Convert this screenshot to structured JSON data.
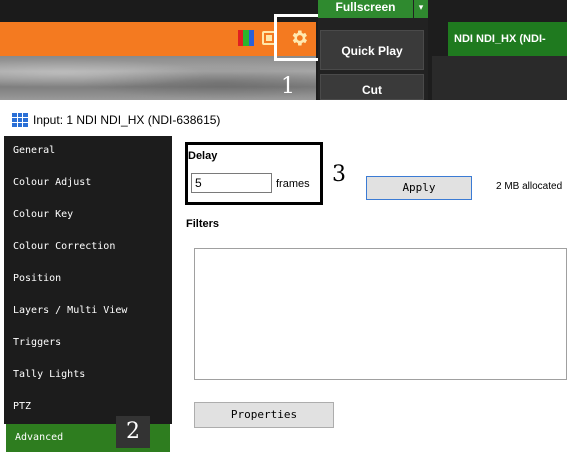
{
  "toolbar": {
    "fullscreen_label": "Fullscreen",
    "quick_play_label": "Quick Play",
    "cut_label": "Cut",
    "preview_title": "NDI NDI_HX (NDI-"
  },
  "callouts": {
    "one": "1",
    "two": "2",
    "three": "3"
  },
  "dialog": {
    "title": "Input: 1 NDI NDI_HX (NDI-638615)"
  },
  "sidebar": {
    "items": [
      {
        "label": "General"
      },
      {
        "label": "Colour Adjust"
      },
      {
        "label": "Colour Key"
      },
      {
        "label": "Colour Correction"
      },
      {
        "label": "Position"
      },
      {
        "label": "Layers / Multi View"
      },
      {
        "label": "Triggers"
      },
      {
        "label": "Tally Lights"
      },
      {
        "label": "PTZ"
      },
      {
        "label": "Advanced"
      }
    ],
    "active": "Advanced"
  },
  "advanced": {
    "delay_label": "Delay",
    "delay_value": "5",
    "frames_label": "frames",
    "apply_label": "Apply",
    "allocated_text": "2 MB allocated",
    "filters_label": "Filters",
    "properties_label": "Properties"
  },
  "colors": {
    "orange_bar": "#f47a20",
    "green_active": "#2e7d1f",
    "sidebar_bg": "#1c1c1c",
    "preview_green": "#1f7a1f"
  }
}
